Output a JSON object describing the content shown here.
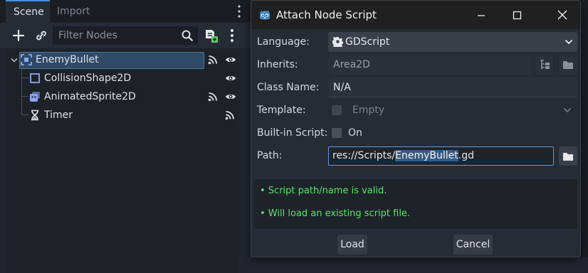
{
  "scene_dock": {
    "tabs": [
      {
        "label": "Scene",
        "active": true
      },
      {
        "label": "Import",
        "active": false
      }
    ],
    "toolbar": {
      "filter_placeholder": "Filter Nodes",
      "icons": [
        "add-icon",
        "link-icon",
        "search-icon",
        "add-script-icon",
        "more-icon"
      ]
    },
    "tree": [
      {
        "label": "EnemyBullet",
        "icon": "area2d-icon",
        "selected": true,
        "signals": true,
        "visible": true
      },
      {
        "label": "CollisionShape2D",
        "icon": "collision-shape-icon",
        "selected": false,
        "signals": false,
        "visible": true
      },
      {
        "label": "AnimatedSprite2D",
        "icon": "animated-sprite-icon",
        "selected": false,
        "signals": true,
        "visible": true
      },
      {
        "label": "Timer",
        "icon": "timer-icon",
        "selected": false,
        "signals": true,
        "visible": false
      }
    ]
  },
  "dialog": {
    "title": "Attach Node Script",
    "fields": {
      "language_label": "Language:",
      "language_value": "GDScript",
      "inherits_label": "Inherits:",
      "inherits_value": "Area2D",
      "classname_label": "Class Name:",
      "classname_value": "N/A",
      "template_label": "Template:",
      "template_value": "Empty",
      "builtin_label": "Built-in Script:",
      "builtin_value": "On",
      "path_label": "Path:",
      "path_prefix": "res://Scripts/",
      "path_selected": "EnemyBullet",
      "path_suffix": ".gd"
    },
    "status": [
      "•  Script path/name is valid.",
      "•  Will load an existing script file."
    ],
    "buttons": {
      "load": "Load",
      "cancel": "Cancel"
    }
  },
  "colors": {
    "accent": "#4790e0",
    "status_ok": "#5ce26a",
    "selection": "#2e4a66"
  }
}
